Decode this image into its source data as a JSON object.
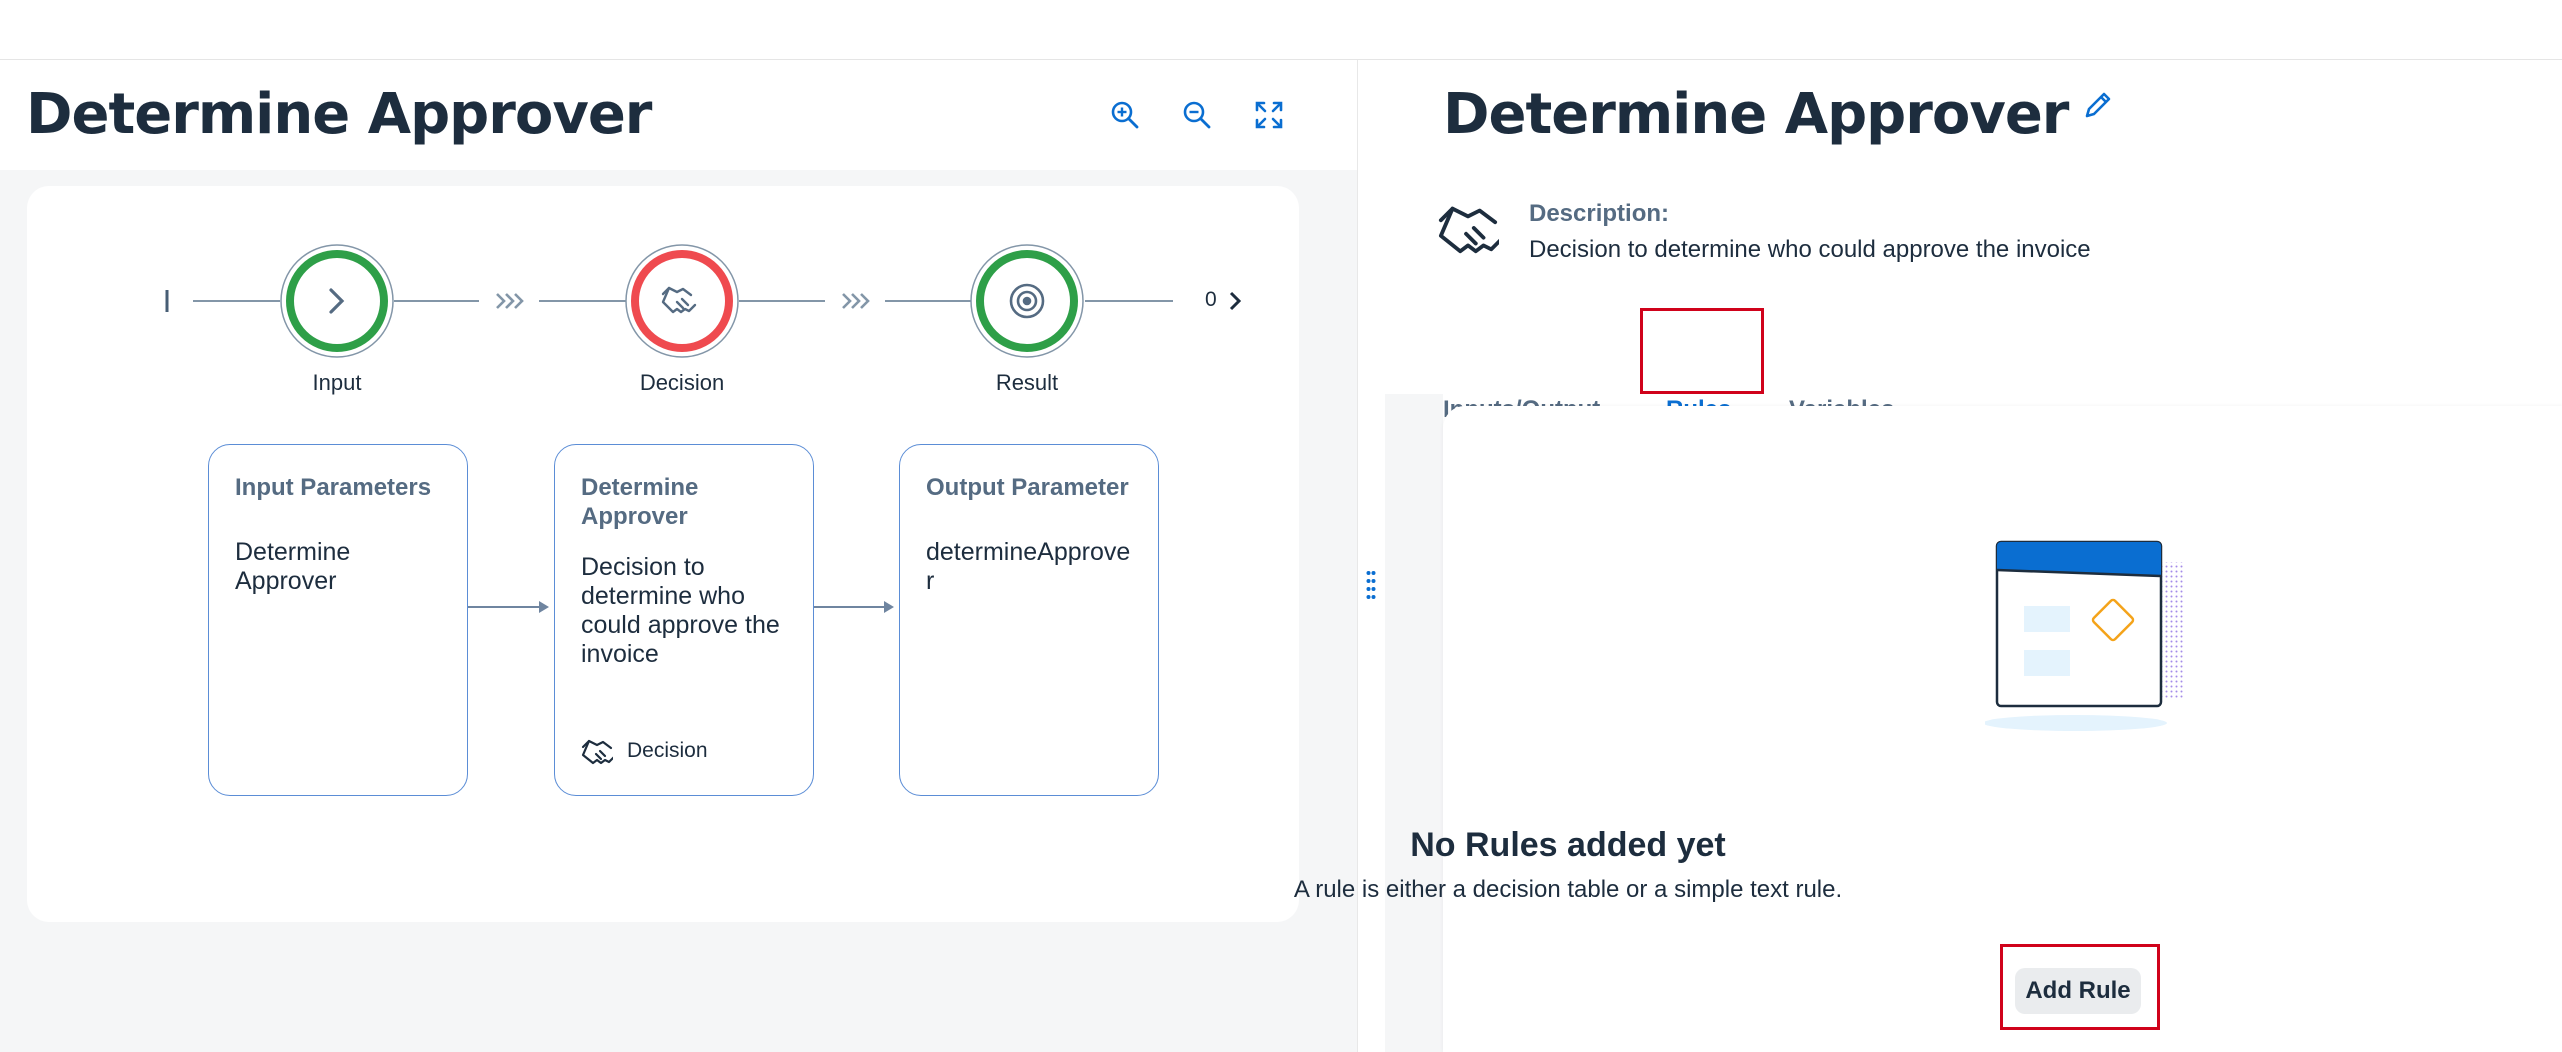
{
  "left": {
    "title": "Determine Approver",
    "toolbar": {
      "zoom_in_icon": "zoom-in-icon",
      "zoom_out_icon": "zoom-out-icon",
      "fit_icon": "fit-screen-icon"
    },
    "steps": [
      {
        "label": "Input",
        "color": "#2e9f48",
        "icon": "chevron-right-icon"
      },
      {
        "label": "Decision",
        "color": "#ef4a4f",
        "icon": "handshake-icon"
      },
      {
        "label": "Result",
        "color": "#2e9f48",
        "icon": "target-icon"
      }
    ],
    "end_count": "0",
    "cards": [
      {
        "title": "Input Parameters",
        "body": "Determine Approver"
      },
      {
        "title": "Determine Approver",
        "body": "Decision to determine who could approve the invoice",
        "footer": "Decision"
      },
      {
        "title": "Output Parameter",
        "body": "determineApprover"
      }
    ]
  },
  "right": {
    "title": "Determine Approver",
    "description_label": "Description:",
    "description_text": "Decision to determine who could approve the invoice",
    "tabs": [
      {
        "label": "Inputs/Output",
        "active": false
      },
      {
        "label": "Rules",
        "active": true
      },
      {
        "label": "Variables",
        "active": false
      }
    ],
    "empty_state": {
      "title": "No Rules added yet",
      "subtitle": "A rule is either a decision table or a simple text rule.",
      "button_label": "Add Rule"
    }
  },
  "colors": {
    "accent": "#0a6ed1",
    "highlight": "#d0021b",
    "success": "#2e9f48",
    "error": "#ef4a4f"
  }
}
